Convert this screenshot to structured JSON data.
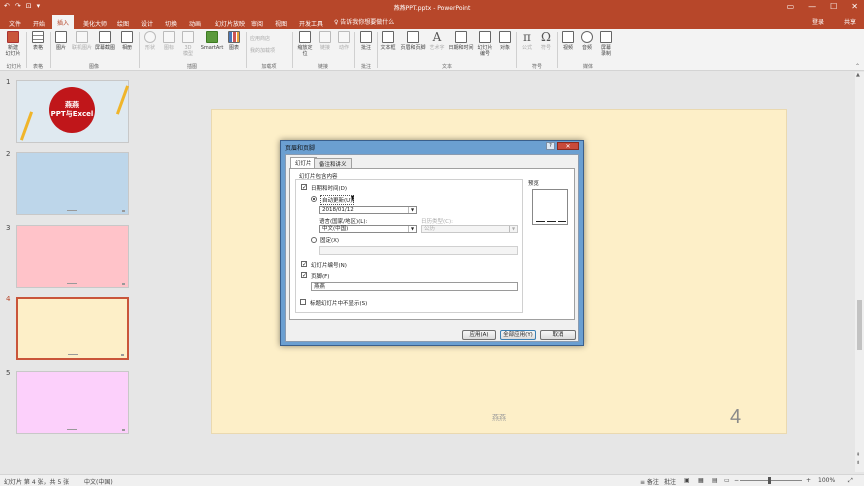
{
  "app": {
    "title": "燕燕PPT.pptx - PowerPoint",
    "login": "登录",
    "share": "共享"
  },
  "qat": [
    "↶",
    "↷",
    "⊡",
    "▾"
  ],
  "window_buttons": [
    "▭",
    "—",
    "☐",
    "✕"
  ],
  "tabs": [
    "文件",
    "开始",
    "插入",
    "美化大师",
    "绘图",
    "设计",
    "切换",
    "动画",
    "幻灯片放映",
    "审阅",
    "视图",
    "开发工具"
  ],
  "active_tab": "插入",
  "tell_me": "♀ 告诉我你想要做什么",
  "ribbon": {
    "new_slide": "新建\n幻灯片",
    "table": "表格",
    "images": [
      "图片",
      "联机图片",
      "屏幕截图",
      "相册"
    ],
    "illustrations": [
      "形状",
      "图标",
      "3D\n模型",
      "SmartArt",
      "图表"
    ],
    "addins": [
      "应用商店",
      "我的加载项"
    ],
    "links": [
      "缩放定\n位",
      "链接",
      "动作"
    ],
    "comment": "批注",
    "text": [
      "文本框",
      "页眉和页脚",
      "艺术字",
      "日期和时间",
      "幻灯片\n编号",
      "对象"
    ],
    "symbols": [
      "公式",
      "符号"
    ],
    "media": [
      "视频",
      "音频",
      "屏幕\n录制"
    ],
    "groups": [
      "幻灯片",
      "表格",
      "图像",
      "插图",
      "加载项",
      "链接",
      "批注",
      "文本",
      "符号",
      "媒体"
    ]
  },
  "thumbnails": [
    {
      "num": "1",
      "bg": "#dfe9f0",
      "title": "燕燕\nPPT与Excel"
    },
    {
      "num": "2",
      "bg": "#bdd6ea"
    },
    {
      "num": "3",
      "bg": "#ffc3c9"
    },
    {
      "num": "4",
      "bg": "#fdefc8"
    },
    {
      "num": "5",
      "bg": "#fcd0fb"
    }
  ],
  "slide": {
    "footer": "燕燕",
    "page_number": "4"
  },
  "dialog": {
    "title": "页眉和页脚",
    "help": "?",
    "close": "✕",
    "tabs": [
      "幻灯片",
      "备注和讲义"
    ],
    "section_label": "幻灯片包含内容",
    "date_time_label": "日期和时间(D)",
    "auto_update_label": "自动更新(U)",
    "date_value": "2018/01/12",
    "language_label": "语言(国家/地区)(L):",
    "language_value": "中文(中国)",
    "calendar_label": "日历类型(C):",
    "calendar_value": "公历",
    "fixed_label": "固定(X)",
    "fixed_value": "",
    "slide_number_label": "幻灯片编号(N)",
    "footer_label": "页脚(F)",
    "footer_value": "燕燕",
    "title_slide_label": "标题幻灯片中不显示(S)",
    "preview_label": "预览",
    "checks": {
      "date_time": true,
      "slide_number": true,
      "footer": true,
      "title_slide": false
    },
    "buttons": {
      "apply": "应用(A)",
      "apply_all": "全部应用(Y)",
      "cancel": "取消"
    }
  },
  "status": {
    "slide_info": "幻灯片 第 4 张，共 5 张",
    "language": "中文(中国)",
    "notes": "≡ 备注",
    "comments": "批注",
    "zoom": "100%"
  }
}
